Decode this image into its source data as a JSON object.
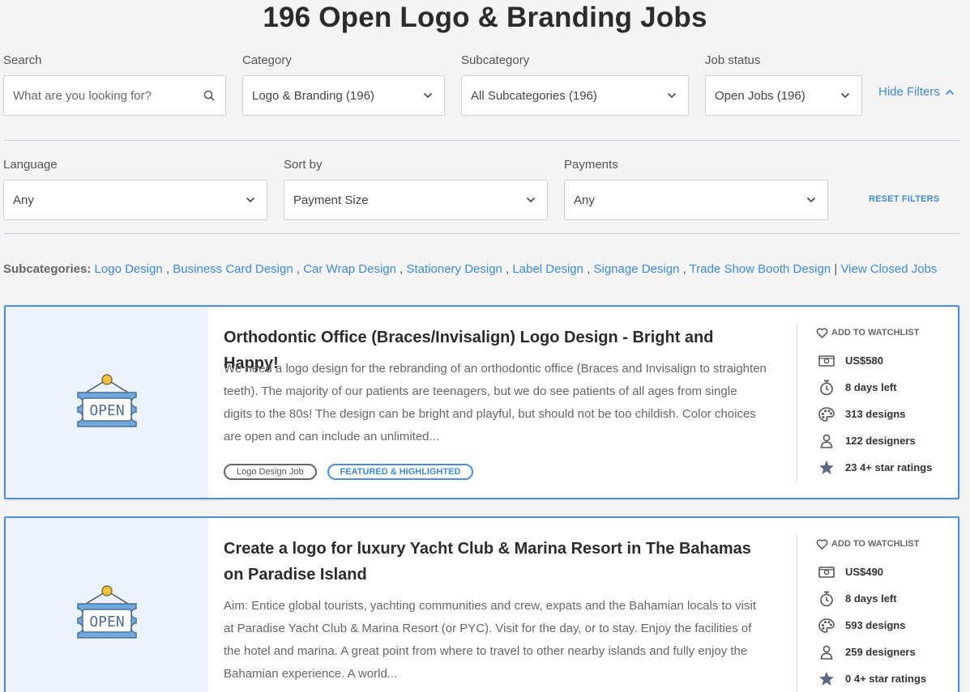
{
  "page": {
    "title": "196 Open Logo & Branding Jobs"
  },
  "filters": {
    "search": {
      "label": "Search",
      "placeholder": "What are you looking for?"
    },
    "category": {
      "label": "Category",
      "value": "Logo & Branding (196)"
    },
    "subcategory": {
      "label": "Subcategory",
      "value": "All Subcategories (196)"
    },
    "job_status": {
      "label": "Job status",
      "value": "Open Jobs (196)"
    },
    "hide_filters": "Hide Filters",
    "language": {
      "label": "Language",
      "value": "Any"
    },
    "sort_by": {
      "label": "Sort by",
      "value": "Payment Size"
    },
    "payments": {
      "label": "Payments",
      "value": "Any"
    },
    "reset": "RESET FILTERS"
  },
  "subcategories": {
    "label": "Subcategories:",
    "links": [
      "Logo Design",
      "Business Card Design",
      "Car Wrap Design",
      "Stationery Design",
      "Label Design",
      "Signage Design",
      "Trade Show Booth Design"
    ],
    "view_closed": "View Closed Jobs"
  },
  "jobs": [
    {
      "thumb_text": "OPEN",
      "title": "Orthodontic Office (Braces/Invisalign) Logo Design - Bright and Happy!",
      "description": "We need a logo design for the rebranding of an orthodontic office (Braces and Invisalign to straighten teeth). The majority of our patients are teenagers, but we do see patients of all ages from single digits to the 80s! The design can be bright and playful, but should not be too childish. Color choices are open and can include an unlimited...",
      "tags": [
        "Logo Design Job",
        "FEATURED & HIGHLIGHTED"
      ],
      "watchlist": "ADD TO WATCHLIST",
      "prize": "US$580",
      "time_left": "8 days left",
      "designs": "313 designs",
      "designers": "122 designers",
      "ratings": "23 4+ star ratings"
    },
    {
      "thumb_text": "OPEN",
      "title": "Create a logo for luxury Yacht Club & Marina Resort in The Bahamas on Paradise Island",
      "description": "Aim: Entice global tourists, yachting communities and crew, expats and the Bahamian locals to visit at Paradise Yacht Club & Marina Resort (or PYC). Visit for the day, or to stay. Enjoy the facilities of the hotel and marina. A great point from where to travel to other nearby islands and fully enjoy the Bahamian experience. A world...",
      "watchlist": "ADD TO WATCHLIST",
      "prize": "US$490",
      "time_left": "8 days left",
      "designs": "593 designs",
      "designers": "259 designers",
      "ratings": "0 4+ star ratings"
    }
  ],
  "colors": {
    "accent": "#3d8bd6",
    "card_border": "#4a90d9",
    "thumb_bg": "#eaf3fc",
    "sign_fill": "#6fa8dc",
    "sign_knob": "#f0c040"
  }
}
